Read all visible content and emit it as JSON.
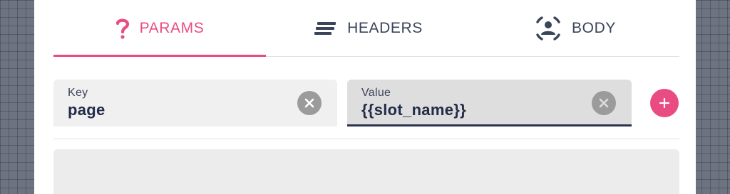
{
  "tabs": [
    {
      "label": "PARAMS",
      "icon": "question-mark-icon",
      "active": true
    },
    {
      "label": "HEADERS",
      "icon": "lines-icon",
      "active": false
    },
    {
      "label": "BODY",
      "icon": "person-frame-icon",
      "active": false
    }
  ],
  "params": {
    "key": {
      "label": "Key",
      "value": "page"
    },
    "value": {
      "label": "Value",
      "value": "{{slot_name}}"
    }
  },
  "colors": {
    "accent": "#e94c83",
    "text_dark": "#232c49",
    "tab_text": "#3b4459",
    "clear_icon_bg": "#9b9b9b"
  }
}
